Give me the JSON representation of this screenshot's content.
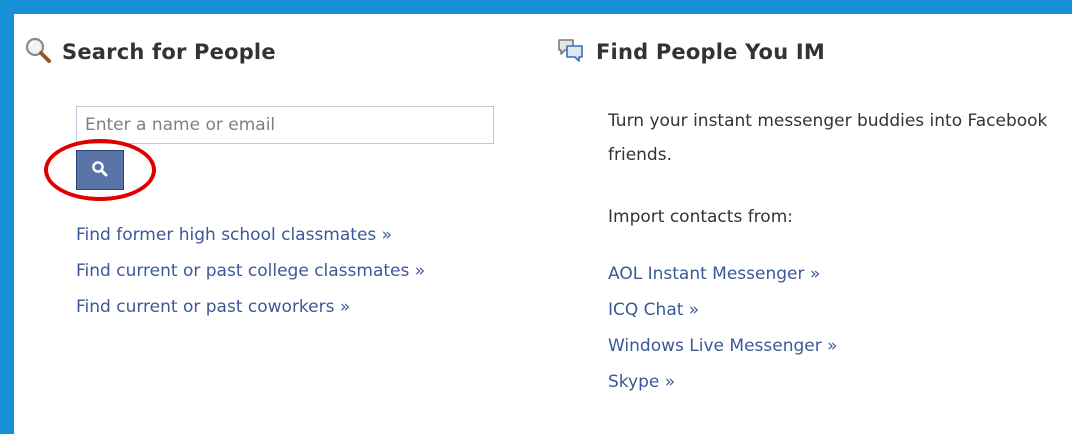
{
  "colors": {
    "frame": "#1690d8",
    "link": "#3b5998",
    "button_bg": "#5b74a8",
    "highlight": "#e00000"
  },
  "search_section": {
    "icon": "magnifier-icon",
    "title": "Search for People",
    "input_placeholder": "Enter a name or email",
    "input_value": "",
    "button_icon": "search-icon",
    "links": [
      "Find former high school classmates »",
      "Find current or past college classmates »",
      "Find current or past coworkers »"
    ]
  },
  "im_section": {
    "icon": "chat-bubbles-icon",
    "title": "Find People You IM",
    "description": "Turn your instant messenger buddies into Facebook friends.",
    "import_label": "Import contacts from:",
    "links": [
      "AOL Instant Messenger »",
      "ICQ Chat »",
      "Windows Live Messenger »",
      "Skype »"
    ]
  }
}
